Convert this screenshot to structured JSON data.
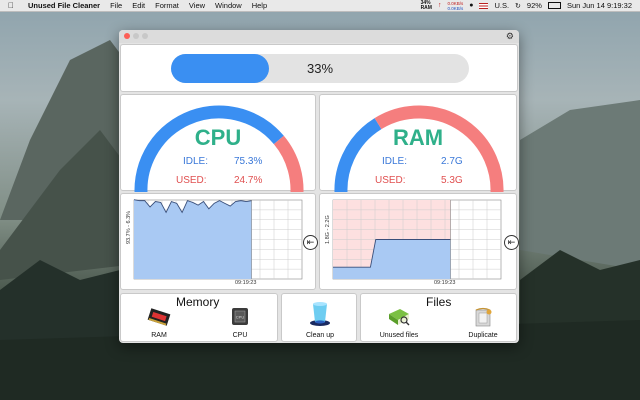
{
  "menubar": {
    "app_name": "Unused File Cleaner",
    "menus": [
      "File",
      "Edit",
      "Format",
      "View",
      "Window",
      "Help"
    ],
    "ram_percent": "34%",
    "ram_label": "RAM",
    "net_up": "0.0KB/s",
    "net_down": "0.0KB/s",
    "input_source": "U.S.",
    "battery": "92%",
    "datetime": "Sun Jun 14  9:19:32"
  },
  "progress": {
    "value": 0.33,
    "label": "33%"
  },
  "cpu": {
    "title": "CPU",
    "idle_label": "IDLE:",
    "idle_value": "75.3%",
    "used_label": "USED:",
    "used_value": "24.7%",
    "used_fraction": 0.247,
    "chart_ylabel": "93.7% - 6.3%",
    "chart_xtick": "09:19:23"
  },
  "ram": {
    "title": "RAM",
    "idle_label": "IDLE:",
    "idle_value": "2.7G",
    "used_label": "USED:",
    "used_value": "5.3G",
    "used_fraction": 0.66,
    "chart_ylabel": "1.8G - 2.2G",
    "chart_xtick": "09:19:23"
  },
  "colors": {
    "blue": "#3a8ff2",
    "red": "#f57e7e",
    "title_green": "#2fb08a",
    "idle_text": "#3a78d8",
    "used_text": "#e05050"
  },
  "memory": {
    "title": "Memory",
    "ram_label": "RAM",
    "cpu_label": "CPU"
  },
  "cleanup": {
    "label": "Clean up"
  },
  "files": {
    "title": "Files",
    "unused_label": "Unused files",
    "duplicate_label": "Duplicate"
  },
  "chart_data": [
    {
      "type": "area",
      "series": [
        {
          "values": [
            94,
            93,
            93,
            86,
            92,
            91,
            80,
            92,
            90,
            80,
            93,
            91,
            88,
            92,
            84,
            90,
            93,
            90,
            87,
            92,
            93,
            92,
            93
          ]
        }
      ],
      "ylim": [
        6.3,
        93.7
      ]
    },
    {
      "type": "area",
      "series": [
        {
          "values": [
            1.86,
            1.86,
            1.86,
            1.86,
            1.86,
            1.86,
            1.86,
            1.86,
            2.0,
            2.0,
            2.0,
            2.0,
            2.0,
            2.0,
            2.0,
            2.0,
            2.0,
            2.0,
            2.0,
            2.0,
            2.0,
            2.0,
            2.0
          ]
        }
      ],
      "ylim": [
        1.8,
        2.2
      ]
    }
  ]
}
